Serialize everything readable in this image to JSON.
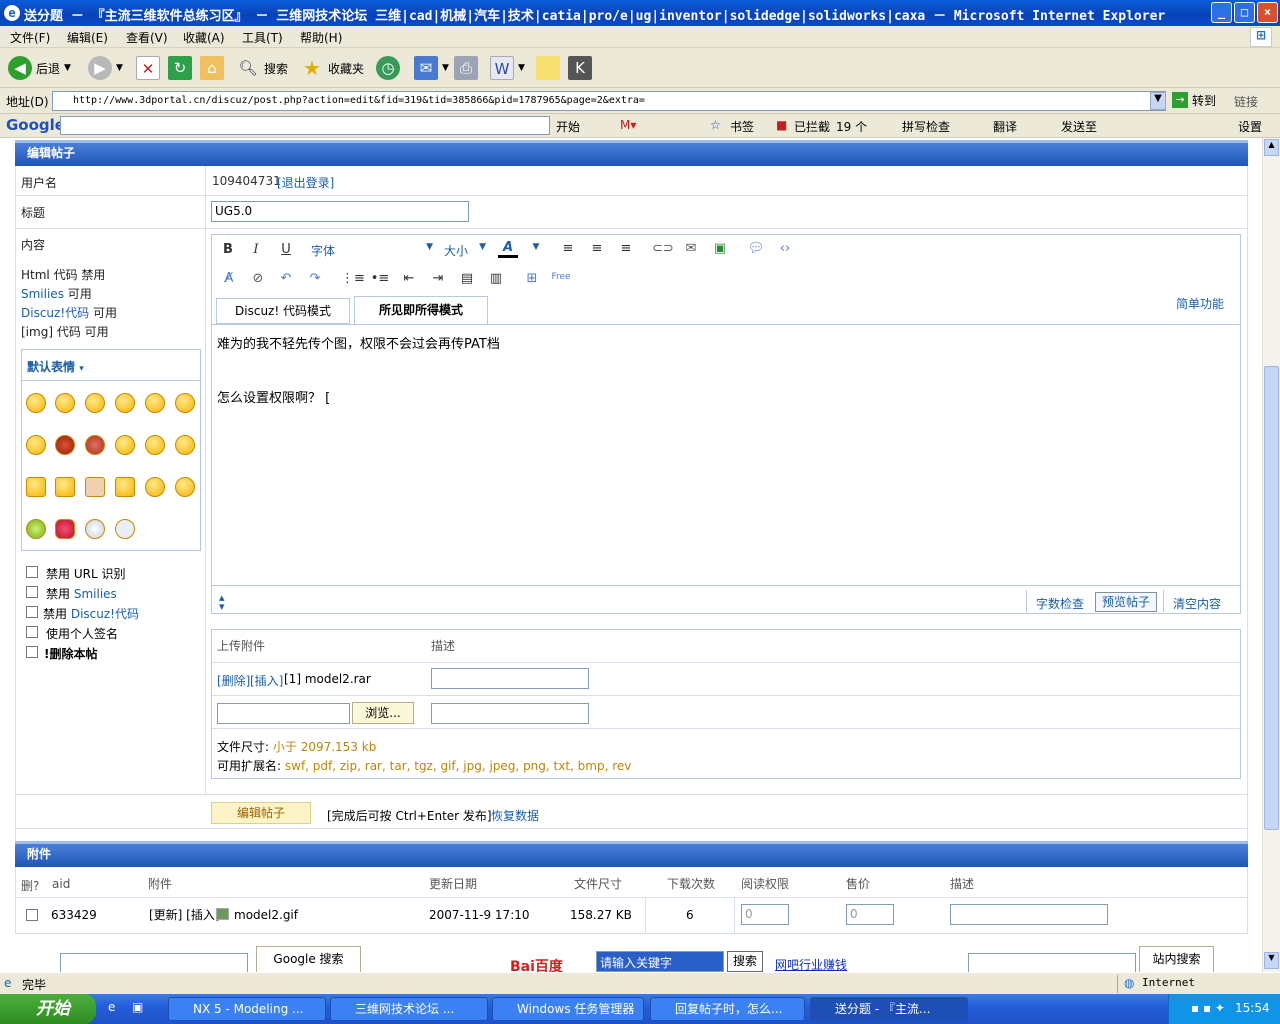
{
  "window": {
    "title": "送分题 － 『主流三维软件总练习区』 － 三维网技术论坛 三维|cad|机械|汽车|技术|catia|pro/e|ug|inventor|solidedge|solidworks|caxa － Microsoft Internet Explorer",
    "buttons": [
      "_",
      "□",
      "×"
    ]
  },
  "menubar": [
    "文件(F)",
    "编辑(E)",
    "查看(V)",
    "收藏(A)",
    "工具(T)",
    "帮助(H)"
  ],
  "toolbar": {
    "back": "后退",
    "search": "搜索",
    "favorites": "收藏夹"
  },
  "addressbar": {
    "label": "地址(D)",
    "url": "http://www.3dportal.cn/discuz/post.php?action=edit&fid=319&tid=385866&pid=1787965&page=2&extra=",
    "go": "转到",
    "links": "链接"
  },
  "googlebar": {
    "logo": "Google",
    "start": "开始",
    "bookmarks": "书签",
    "blocked": "已拦截",
    "blocked_count": "19 个",
    "spell": "拼写检查",
    "translate": "翻译",
    "send": "发送至",
    "settings": "设置"
  },
  "edit_panel": {
    "header": "编辑帖子",
    "username_label": "用户名",
    "username_value": "109404731",
    "logout": "[退出登录]",
    "title_label": "标题",
    "title_value": "UG5.0",
    "content_label": "内容",
    "html_code": "Html 代码",
    "html_state": "禁用",
    "smilies": "Smilies",
    "smilies_state": "可用",
    "discuz_code": "Discuz!代码",
    "discuz_state": "可用",
    "img_code": "[img] 代码",
    "img_state": "可用",
    "emoticons_label": "默认表情",
    "options": [
      {
        "pre": "禁用",
        "name": "URL 识别"
      },
      {
        "pre": "禁用",
        "name": "Smilies"
      },
      {
        "pre": "禁用",
        "name": "Discuz!代码"
      },
      {
        "pre": "",
        "name": "使用个人签名"
      },
      {
        "pre": "",
        "name": "!删除本帖"
      }
    ]
  },
  "editor": {
    "font": "字体",
    "size": "大小",
    "tab_code": "Discuz! 代码模式",
    "tab_wysiwyg": "所见即所得模式",
    "simple": "简单功能",
    "line1": "难为的我不轻先传个图，权限不会过会再传PAT档",
    "line2": "怎么设置权限啊？ [",
    "word_check": "字数检查",
    "preview": "预览帖子",
    "clear": "清空内容"
  },
  "upload": {
    "col_attach": "上传附件",
    "col_desc": "描述",
    "delete": "[删除]",
    "insert": "[插入]",
    "file": "[1] model2.rar",
    "browse": "浏览...",
    "size_label": "文件尺寸:",
    "size_value": "小于  2097.153 kb",
    "ext_label": "可用扩展名:",
    "ext_value": "swf, pdf, zip, rar, tar, tgz, gif, jpg, jpeg, png, txt, bmp, rev"
  },
  "submit": {
    "button": "编辑帖子",
    "hint": "[完成后可按  Ctrl+Enter 发布]",
    "restore": "恢复数据"
  },
  "attachments": {
    "header": "附件",
    "columns": [
      "删?",
      "aid",
      "附件",
      "更新日期",
      "文件尺寸",
      "下载次数",
      "阅读权限",
      "售价",
      "描述"
    ],
    "rows": [
      {
        "aid": "633429",
        "actions": "[更新] [插入]",
        "file": "model2.gif",
        "date": "2007-11-9 17:10",
        "size": "158.27 KB",
        "downloads": "6",
        "perm": "0",
        "price": "0"
      }
    ]
  },
  "footer": {
    "google_search": "Google 搜索",
    "baidu": "Bai百度",
    "baidu_placeholder": "请输入关键字",
    "baidu_search": "搜索",
    "ad_link": "网吧行业赚钱",
    "site_search": "站内搜索"
  },
  "status": {
    "text": "完毕",
    "zone": "Internet"
  },
  "taskbar": {
    "start": "开始",
    "tasks": [
      "NX 5 - Modeling ...",
      "三维网技术论坛 ...",
      "Windows 任务管理器",
      "回复帖子时，怎么...",
      "送分题 - 『主流..."
    ],
    "clock": "15:54"
  },
  "colors": {
    "accent": "#1f56b8",
    "link": "#1a5ea8",
    "hint": "#b8860b"
  }
}
